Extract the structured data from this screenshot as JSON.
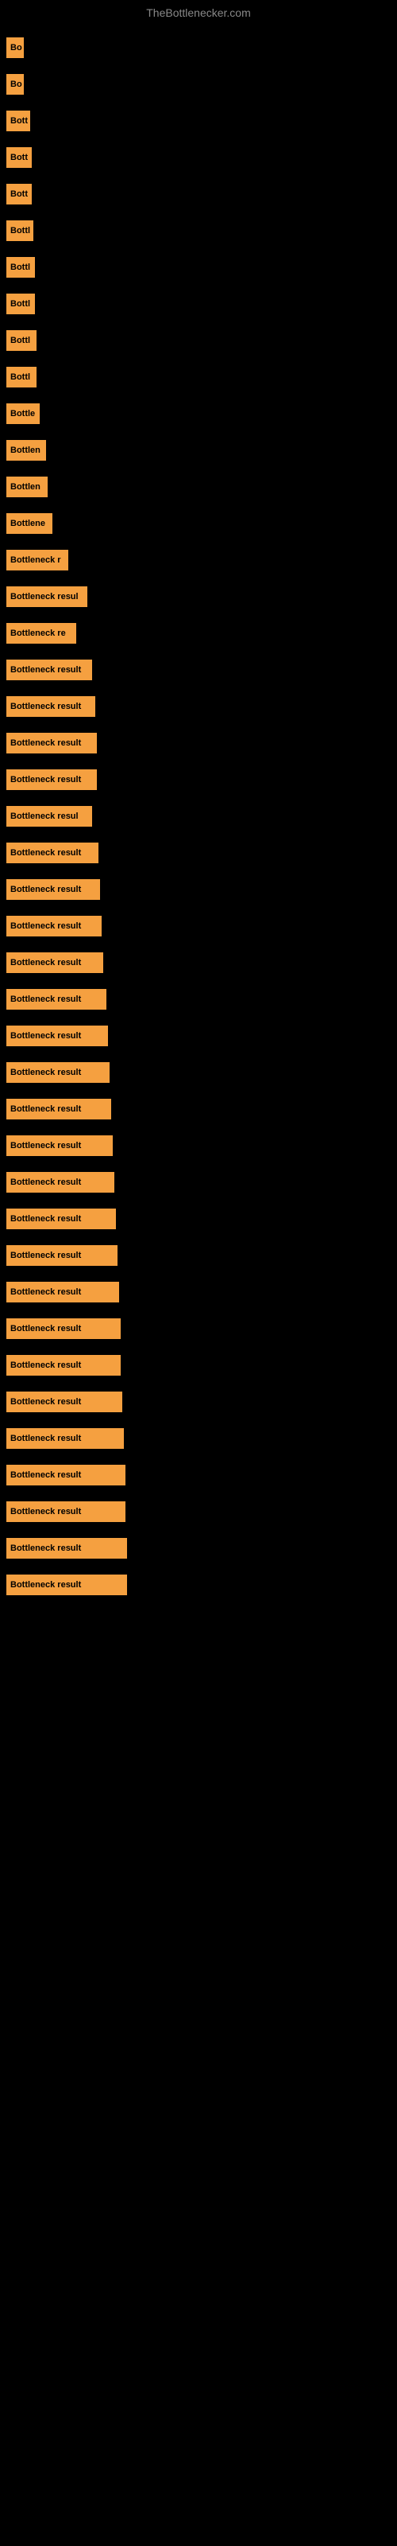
{
  "site": {
    "title": "TheBottlenecker.com"
  },
  "items": [
    {
      "label": "Bo",
      "width": 22
    },
    {
      "label": "Bo",
      "width": 22
    },
    {
      "label": "Bott",
      "width": 30
    },
    {
      "label": "Bott",
      "width": 32
    },
    {
      "label": "Bott",
      "width": 32
    },
    {
      "label": "Bottl",
      "width": 34
    },
    {
      "label": "Bottl",
      "width": 36
    },
    {
      "label": "Bottl",
      "width": 36
    },
    {
      "label": "Bottl",
      "width": 38
    },
    {
      "label": "Bottl",
      "width": 38
    },
    {
      "label": "Bottle",
      "width": 42
    },
    {
      "label": "Bottlen",
      "width": 50
    },
    {
      "label": "Bottlen",
      "width": 52
    },
    {
      "label": "Bottlene",
      "width": 58
    },
    {
      "label": "Bottleneck r",
      "width": 78
    },
    {
      "label": "Bottleneck resul",
      "width": 102
    },
    {
      "label": "Bottleneck re",
      "width": 88
    },
    {
      "label": "Bottleneck result",
      "width": 108
    },
    {
      "label": "Bottleneck result",
      "width": 112
    },
    {
      "label": "Bottleneck result",
      "width": 114
    },
    {
      "label": "Bottleneck result",
      "width": 114
    },
    {
      "label": "Bottleneck resul",
      "width": 108
    },
    {
      "label": "Bottleneck result",
      "width": 116
    },
    {
      "label": "Bottleneck result",
      "width": 118
    },
    {
      "label": "Bottleneck result",
      "width": 120
    },
    {
      "label": "Bottleneck result",
      "width": 122
    },
    {
      "label": "Bottleneck result",
      "width": 126
    },
    {
      "label": "Bottleneck result",
      "width": 128
    },
    {
      "label": "Bottleneck result",
      "width": 130
    },
    {
      "label": "Bottleneck result",
      "width": 132
    },
    {
      "label": "Bottleneck result",
      "width": 134
    },
    {
      "label": "Bottleneck result",
      "width": 136
    },
    {
      "label": "Bottleneck result",
      "width": 138
    },
    {
      "label": "Bottleneck result",
      "width": 140
    },
    {
      "label": "Bottleneck result",
      "width": 142
    },
    {
      "label": "Bottleneck result",
      "width": 144
    },
    {
      "label": "Bottleneck result",
      "width": 144
    },
    {
      "label": "Bottleneck result",
      "width": 146
    },
    {
      "label": "Bottleneck result",
      "width": 148
    },
    {
      "label": "Bottleneck result",
      "width": 150
    },
    {
      "label": "Bottleneck result",
      "width": 150
    },
    {
      "label": "Bottleneck result",
      "width": 152
    },
    {
      "label": "Bottleneck result",
      "width": 152
    }
  ]
}
